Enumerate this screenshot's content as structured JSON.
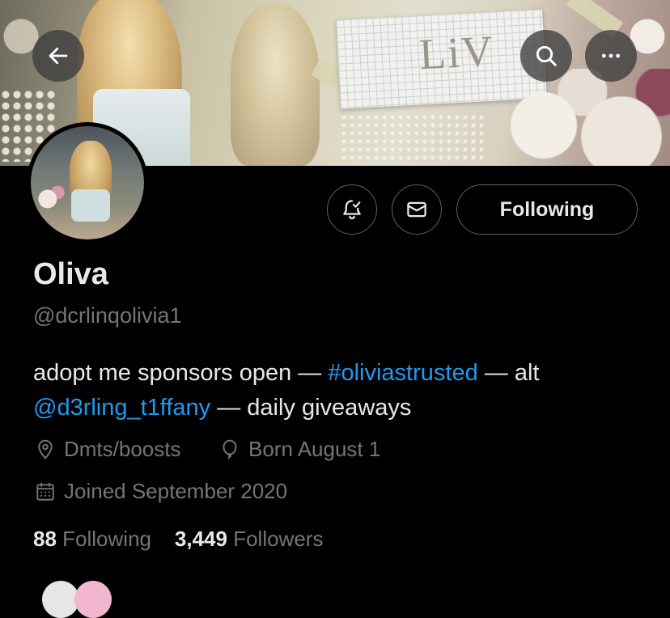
{
  "banner": {
    "text": "LiV"
  },
  "header": {
    "back": {
      "icon": "arrow-left-icon"
    },
    "search": {
      "icon": "search-icon"
    },
    "more": {
      "icon": "more-horizontal-icon"
    }
  },
  "actions": {
    "notify": {
      "icon": "bell-check-icon"
    },
    "message": {
      "icon": "envelope-icon"
    },
    "following_label": "Following"
  },
  "profile": {
    "name": "Oliva",
    "handle": "@dcrlinqolivia1",
    "bio": {
      "part1": "adopt me sponsors open — ",
      "hashtag": "#oliviastrusted",
      "part2": " — alt",
      "mention": "@d3rling_t1ffany",
      "part3": " — daily giveaways"
    },
    "location": "Dmts/boosts",
    "birthday": "Born August 1",
    "joined": "Joined September 2020",
    "following_count": "88",
    "following_label": "Following",
    "followers_count": "3,449",
    "followers_label": "Followers"
  },
  "colors": {
    "background": "#000000",
    "text_primary": "#e7e9ea",
    "text_secondary": "#71767b",
    "link": "#1d9bf0",
    "border": "#536471"
  }
}
